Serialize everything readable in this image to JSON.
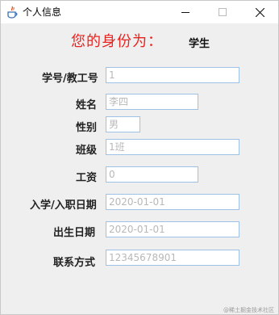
{
  "window": {
    "title": "个人信息",
    "controls": {
      "minimize": "minimize",
      "maximize": "maximize",
      "close": "close"
    }
  },
  "heading": "您的身份为：",
  "role": "学生",
  "form": [
    {
      "label": "学号/教工号",
      "value": "1"
    },
    {
      "label": "姓名",
      "value": "李四"
    },
    {
      "label": "性别",
      "value": "男"
    },
    {
      "label": "班级",
      "value": "1班"
    },
    {
      "label": "工资",
      "value": "0"
    },
    {
      "label": "入学/入职日期",
      "value": "2020-01-01"
    },
    {
      "label": "出生日期",
      "value": "2020-01-01"
    },
    {
      "label": "联系方式",
      "value": "12345678901"
    }
  ],
  "watermark": "@稀土掘金技术社区",
  "colors": {
    "heading": "#e8231f",
    "field_border": "#9ec2e6",
    "field_text": "#b8b8b8"
  }
}
